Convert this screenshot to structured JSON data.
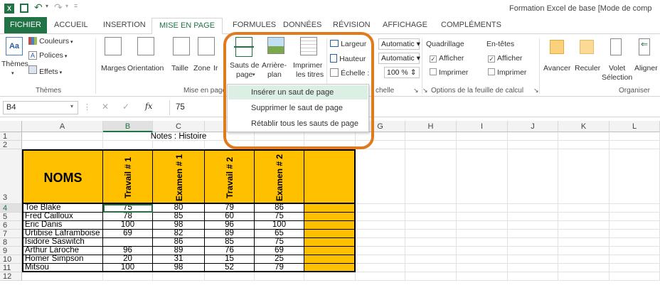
{
  "window": {
    "title": "Formation Excel de base  [Mode de comp"
  },
  "ribbon_tabs": [
    "FICHIER",
    "ACCUEIL",
    "INSERTION",
    "MISE EN PAGE",
    "FORMULES",
    "DONNÉES",
    "RÉVISION",
    "AFFICHAGE",
    "COMPLÉMENTS"
  ],
  "active_tab": "MISE EN PAGE",
  "groups": {
    "themes": {
      "label": "Thèmes",
      "themes_btn": "Thèmes",
      "couleurs": "Couleurs",
      "polices": "Polices",
      "effets": "Effets"
    },
    "mise_en_page": {
      "label": "Mise en page",
      "marges": "Marges",
      "orientation": "Orientation",
      "taille": "Taille",
      "zone": "Zone",
      "imprimer_short": "Ir",
      "sauts_line1": "Sauts de",
      "sauts_line2": "page",
      "arriere_line1": "Arrière-",
      "arriere_line2": "plan",
      "imprimer_line1": "Imprimer",
      "imprimer_line2": "les titres"
    },
    "mise_a_echelle": {
      "label": "chelle",
      "largeur": "Largeur",
      "hauteur": "Hauteur",
      "echelle": "Échelle :",
      "largeur_val": "Automatic",
      "hauteur_val": "Automatic",
      "echelle_val": "100 %"
    },
    "options": {
      "label": "Options de la feuille de calcul",
      "quadrillage": "Quadrillage",
      "entetes": "En-têtes",
      "afficher": "Afficher",
      "imprimer": "Imprimer"
    },
    "organiser": {
      "label": "Organiser",
      "avancer": "Avancer",
      "reculer": "Reculer",
      "volet_line1": "Volet",
      "volet_line2": "Sélection",
      "aligner": "Aligner"
    }
  },
  "dropdown": {
    "items": [
      "Insérer un saut de page",
      "Supprimer le saut de page",
      "Rétablir tous les sauts de page"
    ],
    "highlighted": 0
  },
  "formula_bar": {
    "name_box": "B4",
    "value": "75",
    "fx": "fx"
  },
  "columns": [
    "A",
    "B",
    "C",
    "D",
    "E",
    "F",
    "G",
    "H",
    "I",
    "J",
    "K",
    "L"
  ],
  "rows": [
    "1",
    "2",
    "3",
    "4",
    "5",
    "6",
    "7",
    "8",
    "9",
    "10",
    "11",
    "12"
  ],
  "sheet": {
    "title": "Notes : Histoire",
    "header_noms": "NOMS",
    "headers": [
      "Travail # 1",
      "Examen # 1",
      "Travail # 2",
      "Examen # 2"
    ],
    "students": [
      {
        "name": "Toe Blake",
        "v": [
          "75",
          "80",
          "79",
          "86"
        ]
      },
      {
        "name": "Fred Cailloux",
        "v": [
          "78",
          "85",
          "60",
          "75"
        ]
      },
      {
        "name": "Eric Danis",
        "v": [
          "100",
          "98",
          "96",
          "100"
        ]
      },
      {
        "name": "Urtibise Laframboise",
        "v": [
          "69",
          "82",
          "89",
          "65"
        ]
      },
      {
        "name": "Isidore Saswitch",
        "v": [
          "",
          "86",
          "85",
          "75"
        ]
      },
      {
        "name": "Arthur Laroche",
        "v": [
          "96",
          "89",
          "76",
          "69"
        ]
      },
      {
        "name": "Homer Simpson",
        "v": [
          "20",
          "31",
          "15",
          "25"
        ]
      },
      {
        "name": "Mitsou",
        "v": [
          "100",
          "98",
          "52",
          "79"
        ]
      }
    ]
  },
  "colors": {
    "excel_green": "#217346",
    "highlight_yellow": "#ffc000",
    "callout_orange": "#e07a1e"
  }
}
